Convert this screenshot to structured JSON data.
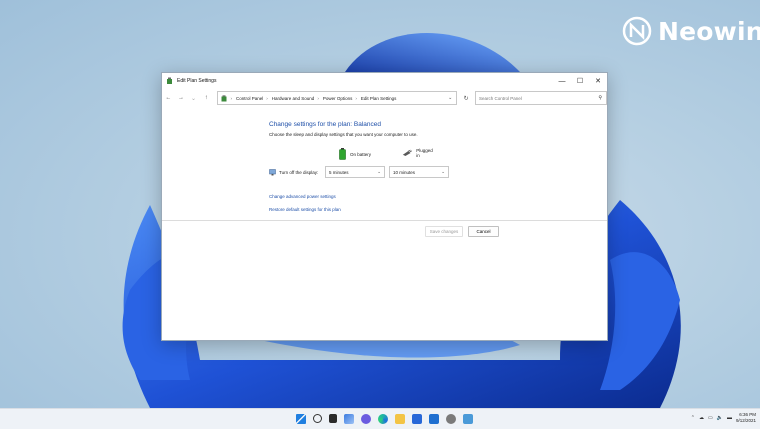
{
  "watermark": {
    "text": "Neowin"
  },
  "window": {
    "title": "Edit Plan Settings",
    "controls": {
      "minimize": "—",
      "maximize": "☐",
      "close": "✕"
    }
  },
  "nav": {
    "back": "←",
    "forward": "→",
    "recent": "⌄",
    "up": "↑",
    "breadcrumbs": [
      "Control Panel",
      "Hardware and Sound",
      "Power Options",
      "Edit Plan Settings"
    ],
    "refresh": "↻",
    "search_placeholder": "Search Control Panel"
  },
  "main": {
    "heading": "Change settings for the plan: Balanced",
    "subtext": "Choose the sleep and display settings that you want your computer to use.",
    "col_battery": "On battery",
    "col_plugged": "Plugged in",
    "display_label": "Turn off the display:",
    "display_battery_value": "5 minutes",
    "display_plugged_value": "10 minutes",
    "link_advanced": "Change advanced power settings",
    "link_restore": "Restore default settings for this plan",
    "save_label": "Save changes",
    "cancel_label": "Cancel"
  },
  "taskbar": {
    "clock_time": "6:36 PM",
    "clock_date": "9/12/2021"
  },
  "colors": {
    "accent_link": "#1e4fa8",
    "wallpaper_blue": "#1f52d6",
    "taskbar_bg": "#eef2f7"
  }
}
